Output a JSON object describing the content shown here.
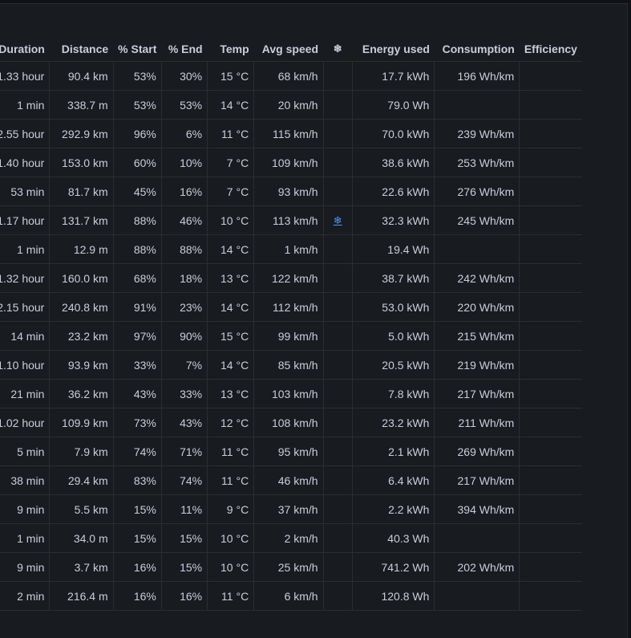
{
  "table": {
    "columns": [
      "Duration",
      "Distance",
      "% Start",
      "% End",
      "Temp",
      "Avg speed",
      "❄",
      "Energy used",
      "Consumption",
      "Efficiency"
    ],
    "rows": [
      [
        "1.33 hour",
        "90.4 km",
        "53%",
        "30%",
        "15 °C",
        "68 km/h",
        "",
        "17.7 kWh",
        "196 Wh/km"
      ],
      [
        "1 min",
        "338.7 m",
        "53%",
        "53%",
        "14 °C",
        "20 km/h",
        "",
        "79.0 Wh",
        ""
      ],
      [
        "2.55 hour",
        "292.9 km",
        "96%",
        "6%",
        "11 °C",
        "115 km/h",
        "",
        "70.0 kWh",
        "239 Wh/km"
      ],
      [
        "1.40 hour",
        "153.0 km",
        "60%",
        "10%",
        "7 °C",
        "109 km/h",
        "",
        "38.6 kWh",
        "253 Wh/km"
      ],
      [
        "53 min",
        "81.7 km",
        "45%",
        "16%",
        "7 °C",
        "93 km/h",
        "",
        "22.6 kWh",
        "276 Wh/km"
      ],
      [
        "1.17 hour",
        "131.7 km",
        "88%",
        "46%",
        "10 °C",
        "113 km/h",
        "❄",
        "32.3 kWh",
        "245 Wh/km"
      ],
      [
        "1 min",
        "12.9 m",
        "88%",
        "88%",
        "14 °C",
        "1 km/h",
        "",
        "19.4 Wh",
        ""
      ],
      [
        "1.32 hour",
        "160.0 km",
        "68%",
        "18%",
        "13 °C",
        "122 km/h",
        "",
        "38.7 kWh",
        "242 Wh/km"
      ],
      [
        "2.15 hour",
        "240.8 km",
        "91%",
        "23%",
        "14 °C",
        "112 km/h",
        "",
        "53.0 kWh",
        "220 Wh/km"
      ],
      [
        "14 min",
        "23.2 km",
        "97%",
        "90%",
        "15 °C",
        "99 km/h",
        "",
        "5.0 kWh",
        "215 Wh/km"
      ],
      [
        "1.10 hour",
        "93.9 km",
        "33%",
        "7%",
        "14 °C",
        "85 km/h",
        "",
        "20.5 kWh",
        "219 Wh/km"
      ],
      [
        "21 min",
        "36.2 km",
        "43%",
        "33%",
        "13 °C",
        "103 km/h",
        "",
        "7.8 kWh",
        "217 Wh/km"
      ],
      [
        "1.02 hour",
        "109.9 km",
        "73%",
        "43%",
        "12 °C",
        "108 km/h",
        "",
        "23.2 kWh",
        "211 Wh/km"
      ],
      [
        "5 min",
        "7.9 km",
        "74%",
        "71%",
        "11 °C",
        "95 km/h",
        "",
        "2.1 kWh",
        "269 Wh/km"
      ],
      [
        "38 min",
        "29.4 km",
        "83%",
        "74%",
        "11 °C",
        "46 km/h",
        "",
        "6.4 kWh",
        "217 Wh/km"
      ],
      [
        "9 min",
        "5.5 km",
        "15%",
        "11%",
        "9 °C",
        "37 km/h",
        "",
        "2.2 kWh",
        "394 Wh/km"
      ],
      [
        "1 min",
        "34.0 m",
        "15%",
        "15%",
        "10 °C",
        "2 km/h",
        "",
        "40.3 Wh",
        ""
      ],
      [
        "9 min",
        "3.7 km",
        "16%",
        "15%",
        "10 °C",
        "25 km/h",
        "",
        "741.2 Wh",
        "202 Wh/km"
      ],
      [
        "2 min",
        "216.4 m",
        "16%",
        "16%",
        "11 °C",
        "6 km/h",
        "",
        "120.8 Wh",
        ""
      ]
    ]
  }
}
